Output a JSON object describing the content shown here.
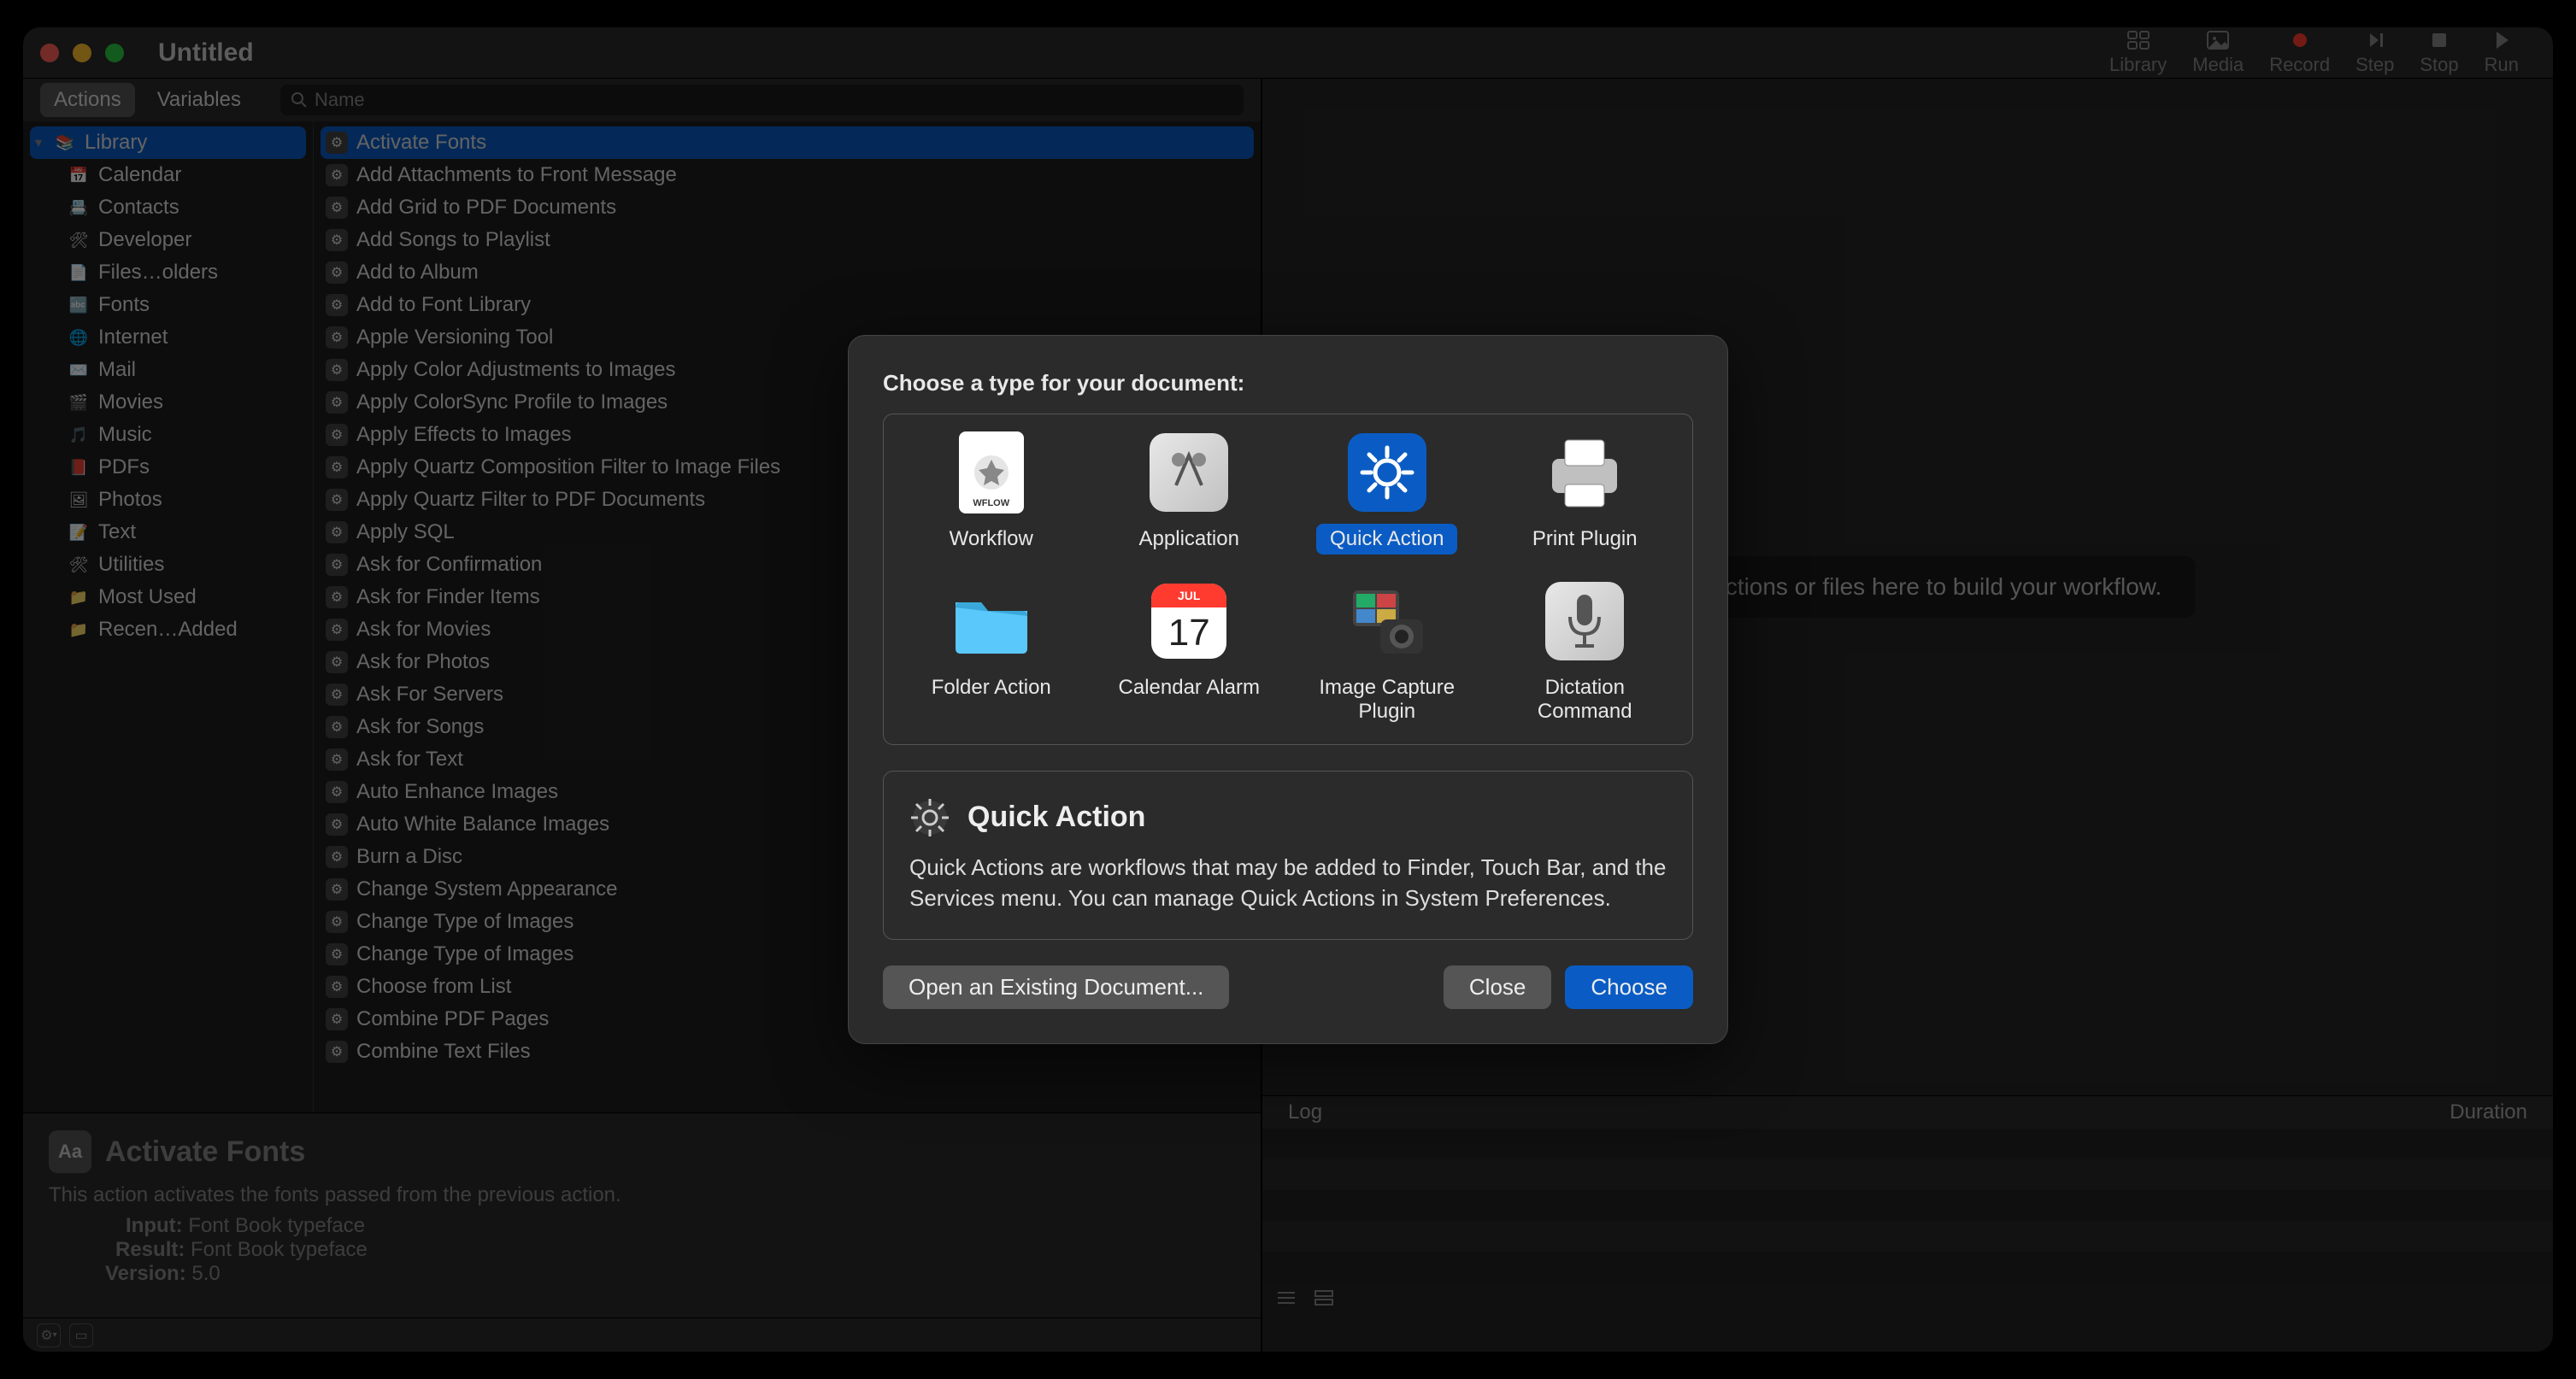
{
  "window": {
    "title": "Untitled"
  },
  "toolbar": [
    {
      "label": "Library",
      "icon": "grid"
    },
    {
      "label": "Media",
      "icon": "photo"
    },
    {
      "label": "Record",
      "icon": "record"
    },
    {
      "label": "Step",
      "icon": "step"
    },
    {
      "label": "Stop",
      "icon": "stop"
    },
    {
      "label": "Run",
      "icon": "play"
    }
  ],
  "tabs": {
    "actions": "Actions",
    "variables": "Variables"
  },
  "search": {
    "placeholder": "Name"
  },
  "library_tree": [
    {
      "label": "Library",
      "icon": "📚",
      "root": true
    },
    {
      "label": "Calendar",
      "icon": "📅"
    },
    {
      "label": "Contacts",
      "icon": "📇"
    },
    {
      "label": "Developer",
      "icon": "🛠"
    },
    {
      "label": "Files…olders",
      "icon": "📄"
    },
    {
      "label": "Fonts",
      "icon": "🔤"
    },
    {
      "label": "Internet",
      "icon": "🌐"
    },
    {
      "label": "Mail",
      "icon": "✉️"
    },
    {
      "label": "Movies",
      "icon": "🎬"
    },
    {
      "label": "Music",
      "icon": "🎵"
    },
    {
      "label": "PDFs",
      "icon": "📕"
    },
    {
      "label": "Photos",
      "icon": "🖼"
    },
    {
      "label": "Text",
      "icon": "📝"
    },
    {
      "label": "Utilities",
      "icon": "🛠"
    },
    {
      "label": "Most Used",
      "icon": "📁",
      "tint": "purple"
    },
    {
      "label": "Recen…Added",
      "icon": "📁",
      "tint": "purple"
    }
  ],
  "actions": [
    "Activate Fonts",
    "Add Attachments to Front Message",
    "Add Grid to PDF Documents",
    "Add Songs to Playlist",
    "Add to Album",
    "Add to Font Library",
    "Apple Versioning Tool",
    "Apply Color Adjustments to Images",
    "Apply ColorSync Profile to Images",
    "Apply Effects to Images",
    "Apply Quartz Composition Filter to Image Files",
    "Apply Quartz Filter to PDF Documents",
    "Apply SQL",
    "Ask for Confirmation",
    "Ask for Finder Items",
    "Ask for Movies",
    "Ask for Photos",
    "Ask For Servers",
    "Ask for Songs",
    "Ask for Text",
    "Auto Enhance Images",
    "Auto White Balance Images",
    "Burn a Disc",
    "Change System Appearance",
    "Change Type of Images",
    "Change Type of Images",
    "Choose from List",
    "Combine PDF Pages",
    "Combine Text Files"
  ],
  "info": {
    "title": "Activate Fonts",
    "desc": "This action activates the fonts passed from the previous action.",
    "input_label": "Input:",
    "input": "Font Book typeface",
    "result_label": "Result:",
    "result": "Font Book typeface",
    "version_label": "Version:",
    "version": "5.0"
  },
  "drop_hint": "Drag actions or files here to build your workflow.",
  "log": {
    "header_left": "Log",
    "header_right": "Duration"
  },
  "dialog": {
    "title": "Choose a type for your document:",
    "types": [
      {
        "label": "Workflow"
      },
      {
        "label": "Application"
      },
      {
        "label": "Quick Action",
        "selected": true
      },
      {
        "label": "Print Plugin"
      },
      {
        "label": "Folder Action"
      },
      {
        "label": "Calendar Alarm"
      },
      {
        "label": "Image Capture Plugin"
      },
      {
        "label": "Dictation Command"
      }
    ],
    "desc_title": "Quick Action",
    "desc_body": "Quick Actions are workflows that may be added to Finder, Touch Bar, and the Services menu. You can manage Quick Actions in System Preferences.",
    "open_btn": "Open an Existing Document...",
    "close_btn": "Close",
    "choose_btn": "Choose"
  }
}
